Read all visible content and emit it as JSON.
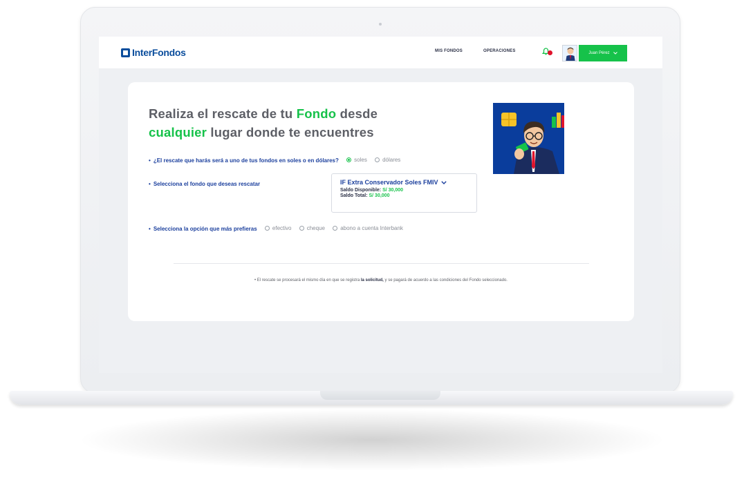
{
  "brand": {
    "name": "InterFondos",
    "accent": "#16c24a",
    "primary": "#0a4d9c"
  },
  "nav": {
    "item1": "MIS FONDOS",
    "item2": "OPERACIONES"
  },
  "user": {
    "name": "Juan Pérez",
    "dropdown_icon": "chevron-down-icon"
  },
  "headline": {
    "part1": "Realiza el rescate de tu ",
    "highlight1": "Fondo",
    "part2": " desde",
    "highlight2": "cualquier",
    "part3": " lugar donde te encuentres"
  },
  "question1": {
    "label": "¿El rescate que harás será a uno de tus fondos en soles o en dólares?",
    "options": [
      {
        "label": "soles",
        "selected": true
      },
      {
        "label": "dólares",
        "selected": false
      }
    ]
  },
  "question2": {
    "label": "Selecciona el fondo que deseas rescatar",
    "fund_name": "IF Extra Conservador Soles FMIV",
    "available_label": "Saldo Disponible:",
    "available_value": "S/ 30,000",
    "total_label": "Saldo Total:",
    "total_value": "S/ 30,000"
  },
  "question3": {
    "label": "Selecciona la opción que más prefieras",
    "options": [
      {
        "label": "efectivo",
        "selected": false
      },
      {
        "label": "cheque",
        "selected": false
      },
      {
        "label": "abono a cuenta Interbank",
        "selected": false
      }
    ]
  },
  "note": {
    "prefix": "• El rescate se procesará el mismo día en que se registra ",
    "bold": "la solicitud,",
    "suffix": " y se pagará de acuerdo a las condiciones del Fondo seleccionado."
  }
}
